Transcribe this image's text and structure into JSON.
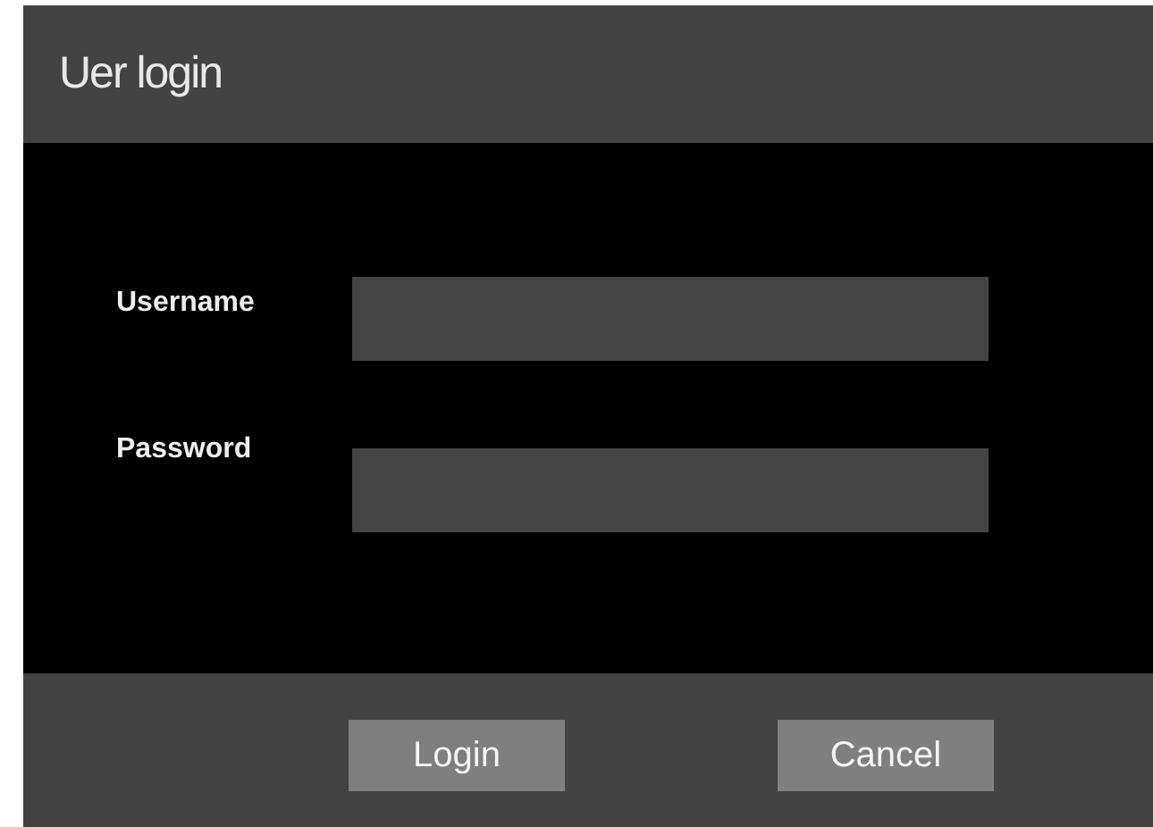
{
  "window": {
    "title": "Uer login"
  },
  "fields": [
    {
      "label": "Username"
    },
    {
      "label": "Password"
    }
  ],
  "buttons": [
    "Login",
    "Cancel"
  ]
}
